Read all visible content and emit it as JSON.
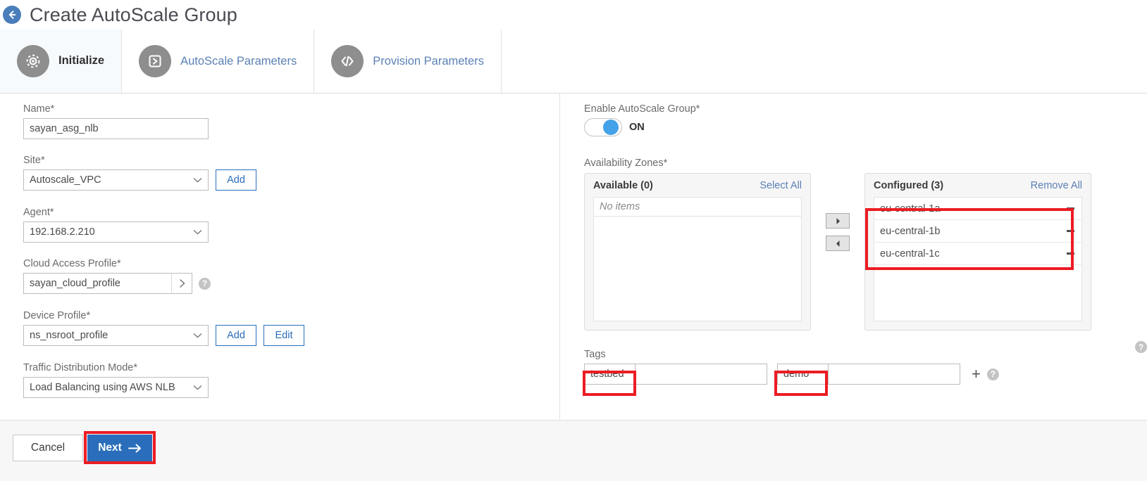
{
  "header": {
    "back_icon": "back-arrow-icon",
    "title": "Create AutoScale Group"
  },
  "tabs": [
    {
      "label": "Initialize",
      "icon": "gear-icon",
      "active": true
    },
    {
      "label": "AutoScale Parameters",
      "icon": "play-box-icon",
      "active": false
    },
    {
      "label": "Provision Parameters",
      "icon": "code-brackets-icon",
      "active": false
    }
  ],
  "left_form": {
    "name": {
      "label": "Name*",
      "value": "sayan_asg_nlb"
    },
    "site": {
      "label": "Site*",
      "value": "Autoscale_VPC",
      "add_label": "Add"
    },
    "agent": {
      "label": "Agent*",
      "value": "192.168.2.210"
    },
    "cloud_access_profile": {
      "label": "Cloud Access Profile*",
      "value": "sayan_cloud_profile",
      "help_icon": "help-icon",
      "expand_icon": "chevron-right-icon"
    },
    "device_profile": {
      "label": "Device Profile*",
      "value": "ns_nsroot_profile",
      "add_label": "Add",
      "edit_label": "Edit"
    },
    "traffic_distribution_mode": {
      "label": "Traffic Distribution Mode*",
      "value": "Load Balancing using AWS NLB"
    }
  },
  "right_form": {
    "enable_group": {
      "label": "Enable AutoScale Group*",
      "state_text": "ON",
      "on": true
    },
    "availability_zones": {
      "label": "Availability Zones*",
      "available": {
        "title": "Available (0)",
        "action": "Select All",
        "empty_text": "No items",
        "items": []
      },
      "configured": {
        "title": "Configured (3)",
        "action": "Remove All",
        "items": [
          "eu-central-1a",
          "eu-central-1b",
          "eu-central-1c"
        ]
      },
      "move_right_icon": "arrow-right-icon",
      "move_left_icon": "arrow-left-icon",
      "help_icon": "help-icon"
    },
    "tags": {
      "label": "Tags",
      "entries": [
        {
          "key": "testbed",
          "value": ""
        },
        {
          "key": "demo",
          "value": ""
        }
      ],
      "add_icon": "plus-icon",
      "help_icon": "help-icon"
    }
  },
  "footer": {
    "cancel_label": "Cancel",
    "next_label": "Next",
    "next_icon": "arrow-right-icon"
  },
  "colors": {
    "accent_blue": "#2a6ebb",
    "toggle_on": "#44a3e8",
    "annotation_red": "#ec1c24",
    "link_blue": "#5b81b5"
  }
}
